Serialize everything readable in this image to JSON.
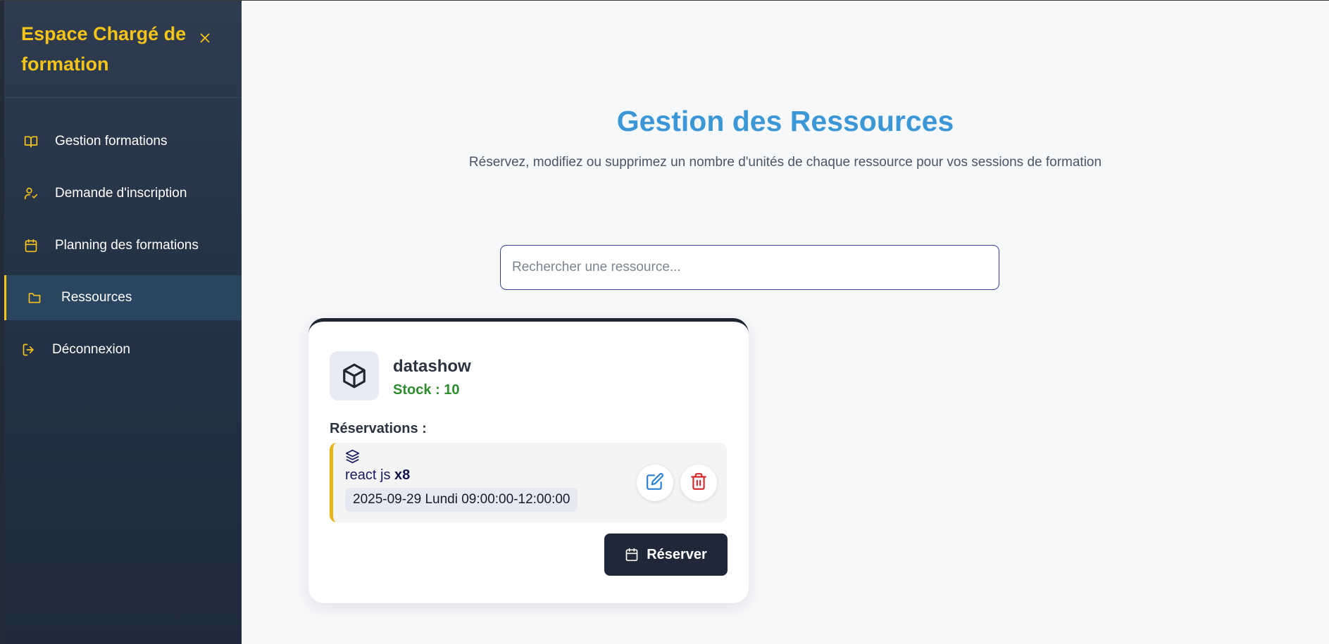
{
  "sidebar": {
    "title": "Espace Chargé de formation",
    "items": [
      {
        "label": "Gestion formations",
        "icon": "book-open-icon"
      },
      {
        "label": "Demande d'inscription",
        "icon": "user-check-icon"
      },
      {
        "label": "Planning des formations",
        "icon": "calendar-icon"
      },
      {
        "label": "Ressources",
        "icon": "folder-icon",
        "active": true
      },
      {
        "label": "Déconnexion",
        "icon": "logout-icon"
      }
    ]
  },
  "main": {
    "title": "Gestion des Ressources",
    "subtitle": "Réservez, modifiez ou supprimez un nombre d'unités de chaque ressource pour vos sessions de formation",
    "search": {
      "placeholder": "Rechercher une ressource...",
      "value": ""
    }
  },
  "resources": [
    {
      "name": "datashow",
      "stock_label": "Stock : 10",
      "reservations_label": "Réservations :",
      "reservations": [
        {
          "formation": "react js",
          "quantity": "x8",
          "date": "2025-09-29 Lundi 09:00:00-12:00:00"
        }
      ],
      "reserve_label": "Réserver"
    }
  ],
  "colors": {
    "accent_yellow": "#f5c418",
    "title_blue": "#3b97d6",
    "stock_green": "#2e8b2e",
    "dark_button": "#1f2838",
    "delete_red": "#d62828",
    "edit_blue": "#2b7fd4"
  }
}
